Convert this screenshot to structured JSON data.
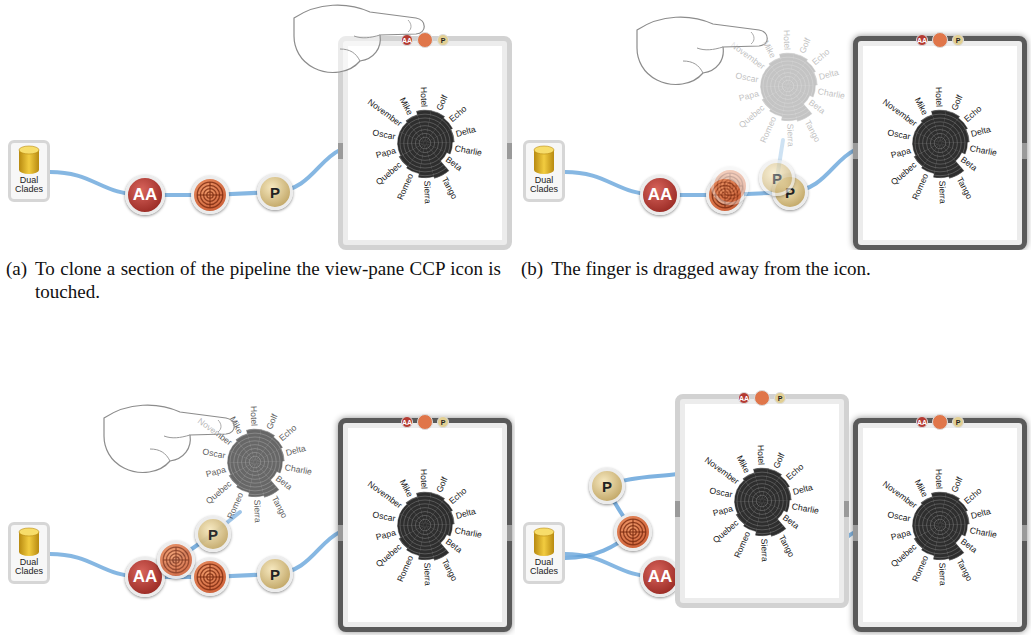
{
  "figure": {
    "pipeline": {
      "source": {
        "label": "Dual Clades"
      },
      "nodes": [
        {
          "kind": "filter",
          "label": "AA"
        },
        {
          "kind": "radial",
          "label": ""
        },
        {
          "kind": "projection",
          "label": "P"
        }
      ]
    },
    "chart": {
      "labels": [
        "Hotel",
        "Golf",
        "Echo",
        "Delta",
        "Charlie",
        "Beta",
        "Tango",
        "Sierra",
        "Romeo",
        "Quebec",
        "Papa",
        "Oscar",
        "November",
        "Mike"
      ],
      "values": [
        0.9,
        0.9,
        0.85,
        0.8,
        0.75,
        0.65,
        1.0,
        0.95,
        0.85,
        0.8,
        0.75,
        0.75,
        0.75,
        0.8
      ]
    },
    "panels": [
      {
        "tag": "(a)",
        "caption": "To clone a section of the pipeline the view-pane CCP icon is touched.",
        "stage": "touch",
        "finger": true,
        "highlighted": false
      },
      {
        "tag": "(b)",
        "caption": "The finger is dragged away from the icon.",
        "stage": "drag",
        "finger": true,
        "highlighted": true
      },
      {
        "stage": "detach",
        "finger": true,
        "highlighted": true
      },
      {
        "stage": "cloned",
        "finger": false,
        "highlighted": true
      }
    ]
  }
}
